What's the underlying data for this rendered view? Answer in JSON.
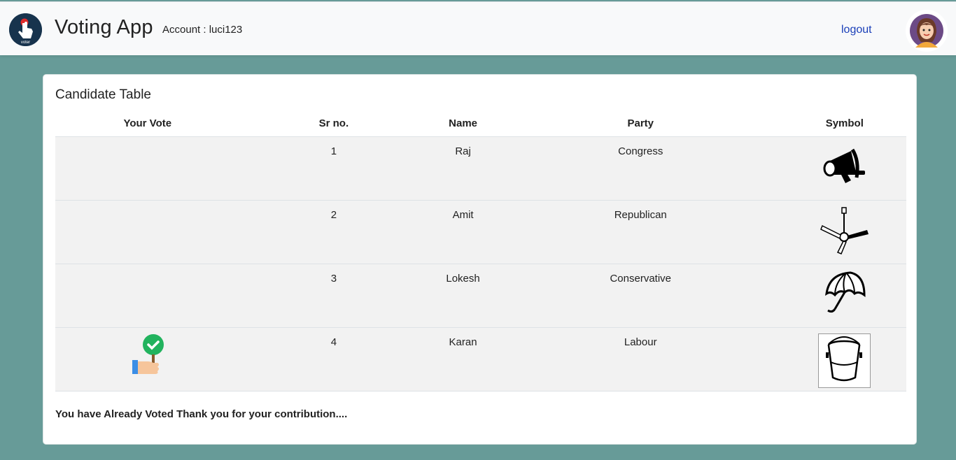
{
  "header": {
    "brand": "Voting App",
    "account": "Account : luci123",
    "logout": "logout",
    "logo_text": "voter"
  },
  "card": {
    "title": "Candidate Table",
    "columns": [
      "Your Vote",
      "Sr no.",
      "Name",
      "Party",
      "Symbol"
    ],
    "rows": [
      {
        "sr": "1",
        "name": "Raj",
        "party": "Congress",
        "symbol": "megaphone-icon",
        "voted": false
      },
      {
        "sr": "2",
        "name": "Amit",
        "party": "Republican",
        "symbol": "ceiling-fan-icon",
        "voted": false
      },
      {
        "sr": "3",
        "name": "Lokesh",
        "party": "Conservative",
        "symbol": "umbrella-icon",
        "voted": false
      },
      {
        "sr": "4",
        "name": "Karan",
        "party": "Labour",
        "symbol": "bucket-icon",
        "voted": true
      }
    ],
    "footer": "You have Already Voted Thank you for your contribution...."
  },
  "colors": {
    "background": "#679b98",
    "link": "#1a3fb8",
    "check": "#22b35e"
  }
}
